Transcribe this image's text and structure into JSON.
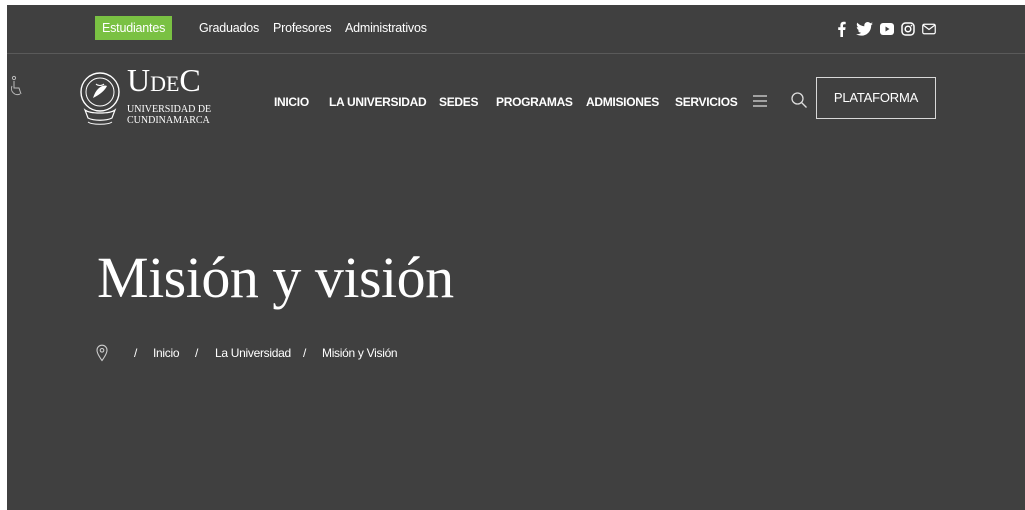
{
  "topbar": {
    "audiences": [
      "Estudiantes",
      "Graduados",
      "Profesores",
      "Administrativos"
    ],
    "active_audience": "Estudiantes",
    "social_icons": [
      "facebook-icon",
      "twitter-icon",
      "youtube-icon",
      "instagram-icon",
      "mail-icon"
    ]
  },
  "brand": {
    "name": "UdeC",
    "subtitle_line1": "Universidad de",
    "subtitle_line2": "Cundinamarca"
  },
  "nav": {
    "items": [
      "INICIO",
      "LA UNIVERSIDAD",
      "SEDES",
      "PROGRAMAS",
      "ADMISIONES",
      "SERVICIOS"
    ],
    "menu_icon": "hamburger-menu-icon",
    "search_icon": "search-icon",
    "platform_button": "PLATAFORMA"
  },
  "hero": {
    "title": "Misión y visión"
  },
  "breadcrumb": {
    "icon": "location-pin-icon",
    "separator": "/",
    "items": [
      "Inicio",
      "La Universidad",
      "Misión y Visión"
    ]
  },
  "colors": {
    "background": "#404040",
    "accent_green": "#7ac143",
    "text": "#ffffff"
  }
}
